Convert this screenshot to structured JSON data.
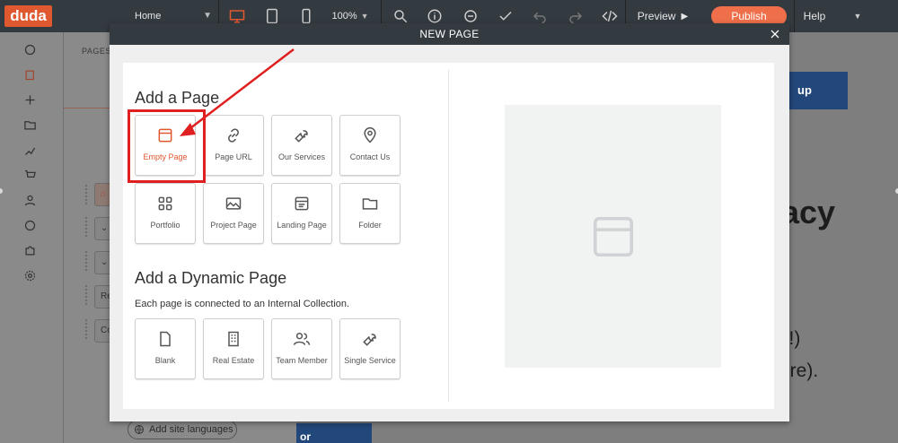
{
  "topbar": {
    "logo": "duda",
    "page_select": "Home",
    "zoom": "100%",
    "preview_label": "Preview",
    "publish_label": "Publish",
    "help_label": "Help"
  },
  "panel": {
    "title": "PAGES",
    "ghost_rows": [
      "Re",
      "Co"
    ]
  },
  "site": {
    "button_text": "up",
    "headline_fragment": "acy",
    "line1": "y!)",
    "line2": "ore).",
    "bottom_button": "or",
    "lang_label": "Add site languages"
  },
  "modal": {
    "title": "NEW PAGE",
    "section1_title": "Add a Page",
    "section2_title": "Add a Dynamic Page",
    "section2_subtitle": "Each page is connected to an Internal Collection.",
    "tiles": [
      {
        "label": "Empty Page",
        "icon": "empty-page-icon"
      },
      {
        "label": "Page URL",
        "icon": "link-icon"
      },
      {
        "label": "Our Services",
        "icon": "wrench-icon"
      },
      {
        "label": "Contact Us",
        "icon": "map-pin-icon"
      },
      {
        "label": "Portfolio",
        "icon": "grid-icon"
      },
      {
        "label": "Project Page",
        "icon": "image-icon"
      },
      {
        "label": "Landing Page",
        "icon": "landing-page-icon"
      },
      {
        "label": "Folder",
        "icon": "folder-icon"
      }
    ],
    "dynamic_tiles": [
      {
        "label": "Blank",
        "icon": "blank-page-icon"
      },
      {
        "label": "Real Estate",
        "icon": "building-icon"
      },
      {
        "label": "Team Member",
        "icon": "users-icon"
      },
      {
        "label": "Single Service",
        "icon": "wrench-icon"
      }
    ]
  },
  "colors": {
    "brand": "#e0582f",
    "topbar": "#333a40",
    "highlight": "#e02020"
  }
}
